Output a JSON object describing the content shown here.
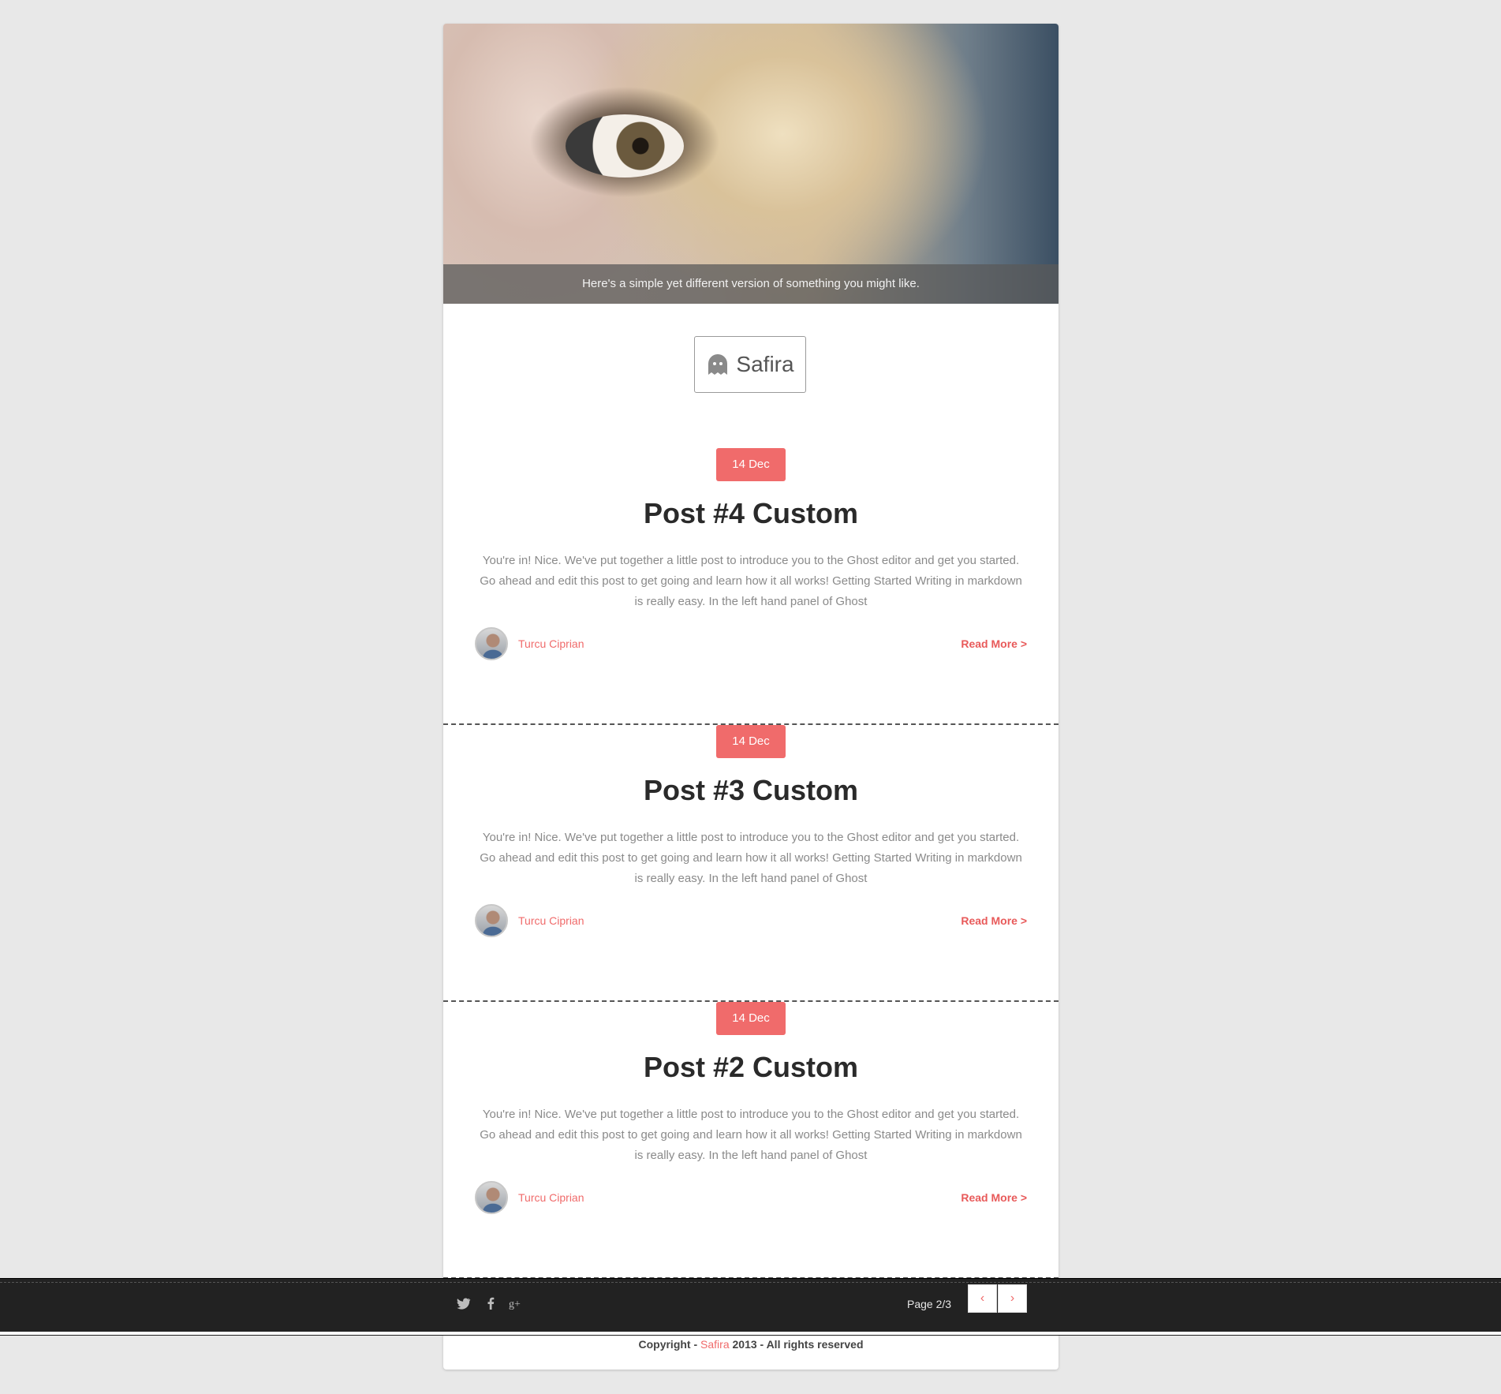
{
  "hero": {
    "caption": "Here's a simple yet different version of something you might like."
  },
  "logo": {
    "text": "Safira",
    "icon": "ghost-icon"
  },
  "posts": [
    {
      "date": "14 Dec",
      "title": "Post #4 Custom",
      "excerpt": "You're in! Nice. We've put together a little post to introduce you to the Ghost editor and get you started. Go ahead and edit this post to get going and learn how it all works! Getting Started Writing in markdown is really easy. In the left hand panel of Ghost",
      "author": "Turcu Ciprian",
      "read_more": "Read More >"
    },
    {
      "date": "14 Dec",
      "title": "Post #3 Custom",
      "excerpt": "You're in! Nice. We've put together a little post to introduce you to the Ghost editor and get you started. Go ahead and edit this post to get going and learn how it all works! Getting Started Writing in markdown is really easy. In the left hand panel of Ghost",
      "author": "Turcu Ciprian",
      "read_more": "Read More >"
    },
    {
      "date": "14 Dec",
      "title": "Post #2 Custom",
      "excerpt": "You're in! Nice. We've put together a little post to introduce you to the Ghost editor and get you started. Go ahead and edit this post to get going and learn how it all works! Getting Started Writing in markdown is really easy. In the left hand panel of Ghost",
      "author": "Turcu Ciprian",
      "read_more": "Read More >"
    }
  ],
  "footer": {
    "social": [
      "twitter-icon",
      "facebook-icon",
      "google-plus-icon"
    ],
    "page_label": "Page 2/3",
    "prev": "‹",
    "next": "›"
  },
  "copyright": {
    "prefix": "Copyright -",
    "brand": "Safira",
    "suffix": "2013 - All rights reserved"
  },
  "colors": {
    "accent": "#f06b6b",
    "background": "#e8e8e8",
    "footer": "#222222"
  }
}
